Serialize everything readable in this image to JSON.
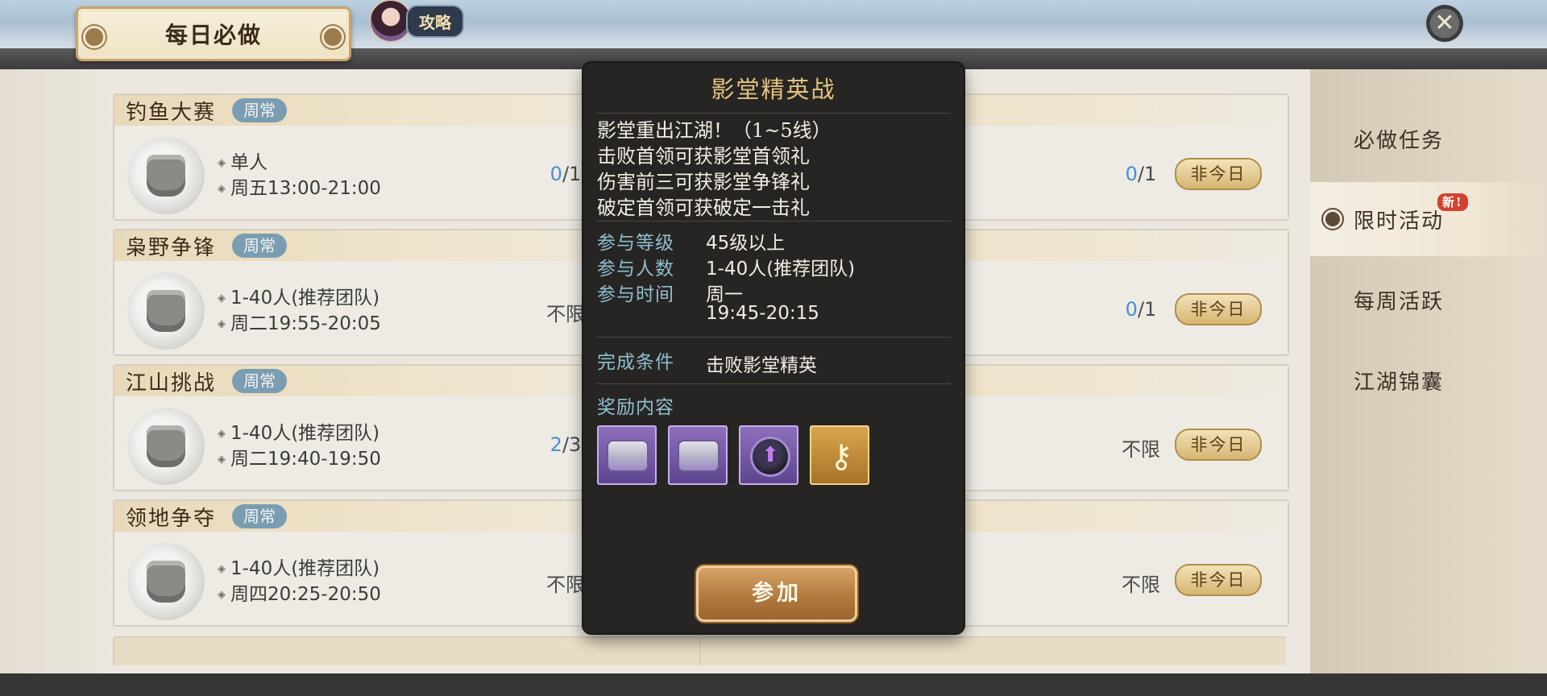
{
  "header": {
    "title": "每日必做",
    "guide_label": "攻略",
    "close_icon": "close-icon"
  },
  "sidebar": {
    "items": [
      {
        "label": "必做任务",
        "active": false
      },
      {
        "label": "限时活动",
        "active": true,
        "badge": "新!"
      },
      {
        "label": "每周活跃",
        "active": false
      },
      {
        "label": "江湖锦囊",
        "active": false
      }
    ]
  },
  "left_cards": [
    {
      "name": "钓鱼大赛",
      "tag": "周常",
      "line1": "单人",
      "line2": "周五13:00-21:00",
      "count_current": "0",
      "count_total": "/1"
    },
    {
      "name": "枭野争锋",
      "tag": "周常",
      "line1": "1-40人(推荐团队)",
      "line2": "周二19:55-20:05",
      "count_text": "不限"
    },
    {
      "name": "江山挑战",
      "tag": "周常",
      "line1": "1-40人(推荐团队)",
      "line2": "周二19:40-19:50",
      "count_current": "2",
      "count_total": "/3"
    },
    {
      "name": "领地争夺",
      "tag": "周常",
      "line1": "1-40人(推荐团队)",
      "line2": "周四20:25-20:50",
      "count_text": "不限"
    }
  ],
  "right_cards": [
    {
      "count_current": "0",
      "count_total": "/1",
      "button": "非今日"
    },
    {
      "count_current": "0",
      "count_total": "/1",
      "button": "非今日"
    },
    {
      "count_text": "不限",
      "button": "非今日"
    },
    {
      "count_text": "不限",
      "button": "非今日"
    }
  ],
  "popup": {
    "title": "影堂精英战",
    "desc": [
      "影堂重出江湖！（1~5线）",
      "击败首领可获影堂首领礼",
      "伤害前三可获影堂争锋礼",
      "破定首领可获破定一击礼"
    ],
    "level_label": "参与等级",
    "level_value": "45级以上",
    "people_label": "参与人数",
    "people_value": "1-40人(推荐团队)",
    "time_label": "参与时间",
    "time_value_1": "周一",
    "time_value_2": "19:45-20:15",
    "condition_label": "完成条件",
    "condition_value": "击败影堂精英",
    "reward_label": "奖励内容",
    "rewards": [
      "purple-chest",
      "purple-chest",
      "purple-gem",
      "gold-key"
    ],
    "join_button": "参加"
  },
  "colors": {
    "tag": "#7a9db2",
    "count_highlight": "#4a8fd6",
    "popup_title": "#e2c47e",
    "popup_key": "#8ec0ce"
  }
}
